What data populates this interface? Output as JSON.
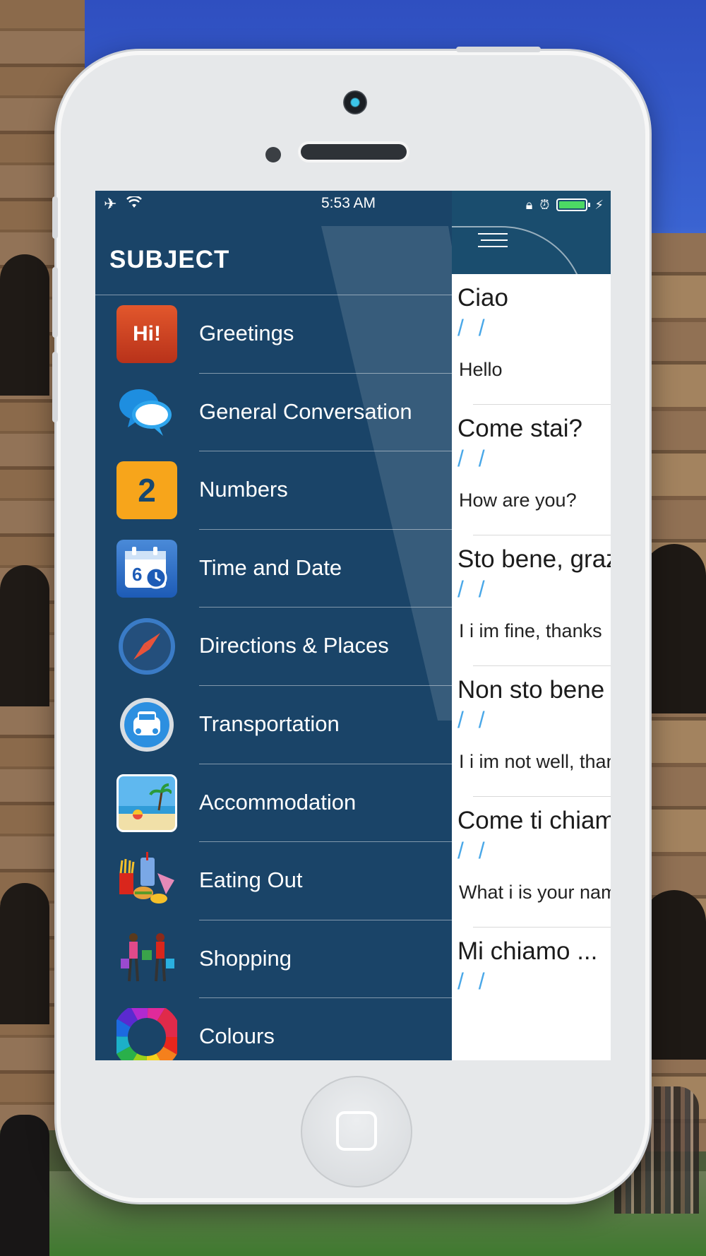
{
  "status_bar": {
    "time": "5:53 AM"
  },
  "menu": {
    "title": "SUBJECT",
    "items": [
      {
        "label": "Greetings",
        "icon": "hi-greeting-icon",
        "glyph": "Hi!"
      },
      {
        "label": "General Conversation",
        "icon": "speech-bubbles-icon"
      },
      {
        "label": "Numbers",
        "icon": "number-two-icon",
        "glyph": "2"
      },
      {
        "label": "Time and Date",
        "icon": "calendar-clock-icon"
      },
      {
        "label": "Directions & Places",
        "icon": "compass-icon"
      },
      {
        "label": "Transportation",
        "icon": "car-icon"
      },
      {
        "label": "Accommodation",
        "icon": "beach-icon"
      },
      {
        "label": "Eating Out",
        "icon": "fast-food-icon"
      },
      {
        "label": "Shopping",
        "icon": "shoppers-icon"
      },
      {
        "label": "Colours",
        "icon": "color-wheel-icon"
      }
    ]
  },
  "phrases": [
    {
      "italian": "Ciao",
      "pron": "/ /",
      "english": "Hello"
    },
    {
      "italian": "Come stai?",
      "pron": "/ /",
      "english": "How are you?"
    },
    {
      "italian": "Sto bene, grazie",
      "pron": "/ /",
      "english": "I i im fine, thanks"
    },
    {
      "italian": "Non sto bene",
      "pron": "/ /",
      "english": "I i im not well, thanks"
    },
    {
      "italian": "Come ti chiami?",
      "pron": "/ /",
      "english": "What i is your name?"
    },
    {
      "italian": "Mi chiamo ...",
      "pron": "/ /",
      "english": ""
    }
  ],
  "colors": {
    "menu_bg": "#1a4468",
    "accent_blue": "#4aa8e8",
    "battery": "#4cd964"
  }
}
